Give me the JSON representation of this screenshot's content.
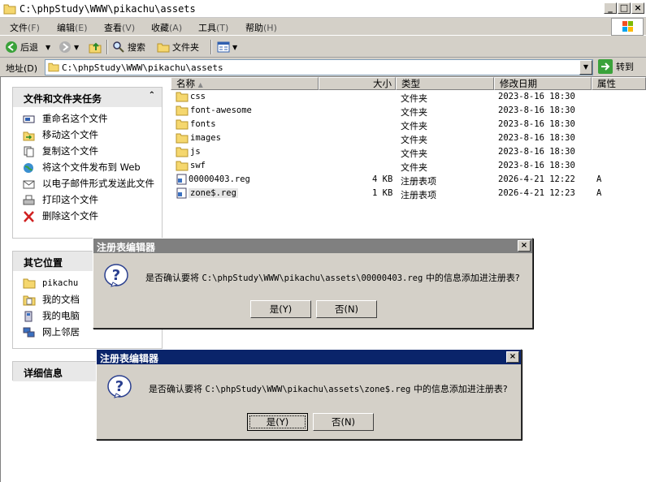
{
  "window": {
    "title": "C:\\phpStudy\\WWW\\pikachu\\assets"
  },
  "menu": [
    {
      "label": "文件",
      "key": "(F)"
    },
    {
      "label": "编辑",
      "key": "(E)"
    },
    {
      "label": "查看",
      "key": "(V)"
    },
    {
      "label": "收藏",
      "key": "(A)"
    },
    {
      "label": "工具",
      "key": "(T)"
    },
    {
      "label": "帮助",
      "key": "(H)"
    }
  ],
  "toolbar": {
    "back": "后退",
    "search": "搜索",
    "folders": "文件夹"
  },
  "address": {
    "label": "地址(D)",
    "value": "C:\\phpStudy\\WWW\\pikachu\\assets",
    "go": "转到"
  },
  "tasks_panel": {
    "title": "文件和文件夹任务",
    "items": [
      "重命名这个文件",
      "移动这个文件",
      "复制这个文件",
      "将这个文件发布到 Web",
      "以电子邮件形式发送此文件",
      "打印这个文件",
      "删除这个文件"
    ]
  },
  "places_panel": {
    "title": "其它位置",
    "items": [
      "pikachu",
      "我的文档",
      "我的电脑",
      "网上邻居"
    ]
  },
  "details_panel": {
    "title": "详细信息"
  },
  "columns": {
    "name": "名称",
    "size": "大小",
    "type": "类型",
    "modified": "修改日期",
    "attr": "属性"
  },
  "files": [
    {
      "name": "css",
      "size": "",
      "type": "文件夹",
      "modified": "2023-8-16 18:30",
      "attr": ""
    },
    {
      "name": "font-awesome",
      "size": "",
      "type": "文件夹",
      "modified": "2023-8-16 18:30",
      "attr": ""
    },
    {
      "name": "fonts",
      "size": "",
      "type": "文件夹",
      "modified": "2023-8-16 18:30",
      "attr": ""
    },
    {
      "name": "images",
      "size": "",
      "type": "文件夹",
      "modified": "2023-8-16 18:30",
      "attr": ""
    },
    {
      "name": "js",
      "size": "",
      "type": "文件夹",
      "modified": "2023-8-16 18:30",
      "attr": ""
    },
    {
      "name": "swf",
      "size": "",
      "type": "文件夹",
      "modified": "2023-8-16 18:30",
      "attr": ""
    },
    {
      "name": "00000403.reg",
      "size": "4 KB",
      "type": "注册表项",
      "modified": "2026-4-21 12:22",
      "attr": "A"
    },
    {
      "name": "zone$.reg",
      "size": "1 KB",
      "type": "注册表项",
      "modified": "2026-4-21 12:23",
      "attr": "A"
    }
  ],
  "dialog1": {
    "title": "注册表编辑器",
    "msg_pre": "是否确认要将 ",
    "path": "C:\\phpStudy\\WWW\\pikachu\\assets\\00000403.reg",
    "msg_post": " 中的信息添加进注册表?",
    "yes": "是(Y)",
    "no": "否(N)"
  },
  "dialog2": {
    "title": "注册表编辑器",
    "msg_pre": "是否确认要将 ",
    "path": "C:\\phpStudy\\WWW\\pikachu\\assets\\zone$.reg",
    "msg_post": " 中的信息添加进注册表?",
    "yes": "是(Y)",
    "no": "否(N)"
  }
}
